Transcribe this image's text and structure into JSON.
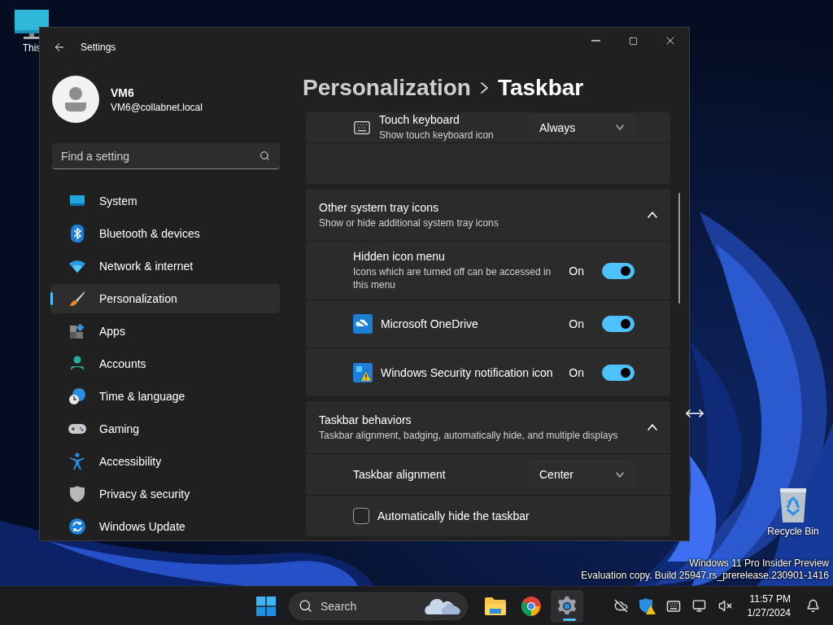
{
  "desktop": {
    "icons": [
      {
        "kind": "computer",
        "label": "This"
      },
      {
        "kind": "recycle",
        "label": "Recycle Bin"
      }
    ],
    "watermark": [
      "Windows 11 Pro Insider Preview",
      "Evaluation copy. Build 25947.rs_prerelease.230901-1416"
    ]
  },
  "window": {
    "title": "Settings",
    "account": {
      "name": "VM6",
      "email": "VM6@collabnet.local"
    },
    "search": {
      "placeholder": "Find a setting"
    },
    "nav": [
      {
        "kind": "system",
        "label": "System",
        "selected": false
      },
      {
        "kind": "bluetooth",
        "label": "Bluetooth & devices",
        "selected": false
      },
      {
        "kind": "network",
        "label": "Network & internet",
        "selected": false
      },
      {
        "kind": "personalization",
        "label": "Personalization",
        "selected": true
      },
      {
        "kind": "apps",
        "label": "Apps",
        "selected": false
      },
      {
        "kind": "accounts",
        "label": "Accounts",
        "selected": false
      },
      {
        "kind": "time",
        "label": "Time & language",
        "selected": false
      },
      {
        "kind": "gaming",
        "label": "Gaming",
        "selected": false
      },
      {
        "kind": "accessibility",
        "label": "Accessibility",
        "selected": false
      },
      {
        "kind": "privacy",
        "label": "Privacy & security",
        "selected": false
      },
      {
        "kind": "update",
        "label": "Windows Update",
        "selected": false
      }
    ],
    "breadcrumb": {
      "parent": "Personalization",
      "current": "Taskbar"
    },
    "sections": [
      {
        "kind": "group",
        "rows": [
          {
            "kind": "dropdown",
            "title": "Touch keyboard",
            "subtitle": "Show touch keyboard icon",
            "value": "Always"
          }
        ]
      },
      {
        "kind": "expander",
        "title": "Other system tray icons",
        "subtitle": "Show or hide additional system tray icons",
        "expanded": true,
        "rows": [
          {
            "kind": "toggle",
            "title": "Hidden icon menu",
            "subtitle": "Icons which are turned off can be accessed in this menu",
            "state_label": "On",
            "on": true
          },
          {
            "kind": "toggle",
            "title": "Microsoft OneDrive",
            "state_label": "On",
            "on": true
          },
          {
            "kind": "toggle",
            "title": "Windows Security notification icon",
            "state_label": "On",
            "on": true
          }
        ]
      },
      {
        "kind": "expander",
        "title": "Taskbar behaviors",
        "subtitle": "Taskbar alignment, badging, automatically hide, and multiple displays",
        "expanded": true,
        "rows": [
          {
            "kind": "dropdown",
            "title": "Taskbar alignment",
            "value": "Center"
          },
          {
            "kind": "checkbox",
            "title": "Automatically hide the taskbar",
            "checked": false
          }
        ]
      }
    ]
  },
  "taskbar": {
    "search": {
      "placeholder": "Search"
    },
    "apps": [
      {
        "kind": "folder",
        "selected": false
      },
      {
        "kind": "browser",
        "selected": false
      },
      {
        "kind": "settings",
        "selected": true
      }
    ],
    "clock": {
      "time": "11:57 PM",
      "date": "1/27/2024"
    }
  }
}
